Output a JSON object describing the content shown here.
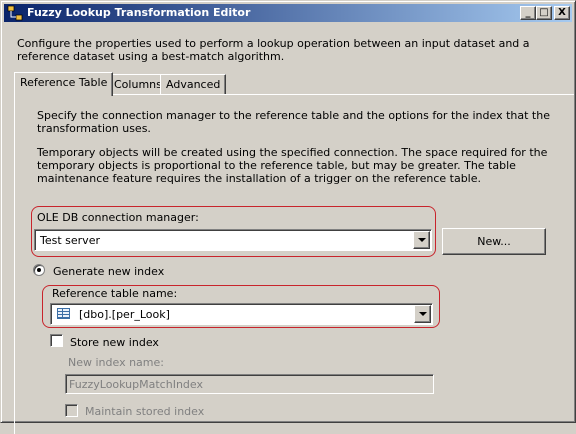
{
  "window": {
    "title": "Fuzzy Lookup Transformation Editor",
    "controls": {
      "minimize": "_",
      "maximize": "□",
      "close": "X"
    }
  },
  "description": "Configure the properties used to perform a lookup operation between an input dataset and a reference dataset using a best-match algorithm.",
  "tabs": [
    {
      "label": "Reference Table",
      "active": true
    },
    {
      "label": "Columns",
      "active": false
    },
    {
      "label": "Advanced",
      "active": false
    }
  ],
  "reference_tab": {
    "intro": "Specify the connection manager to the reference table and the options for the index that the transformation uses.",
    "note": "Temporary objects will be created using the specified connection. The space required for the temporary objects is proportional to the reference table, but may be greater. The table maintenance feature requires the installation of a trigger on the reference table.",
    "connection_label": "OLE DB connection manager:",
    "connection_value": "Test server",
    "new_button": "New...",
    "generate_index_label": "Generate new index",
    "reference_table_label": "Reference table name:",
    "reference_table_value": "[dbo].[per_Look]",
    "store_index_label": "Store new index",
    "new_index_name_label": "New index name:",
    "new_index_name_value": "FuzzyLookupMatchIndex",
    "maintain_index_label": "Maintain stored index"
  },
  "colors": {
    "highlight": "#c8242c",
    "titlebar_start": "#0a246a",
    "titlebar_end": "#a6caf0",
    "face": "#d4d0c8"
  }
}
